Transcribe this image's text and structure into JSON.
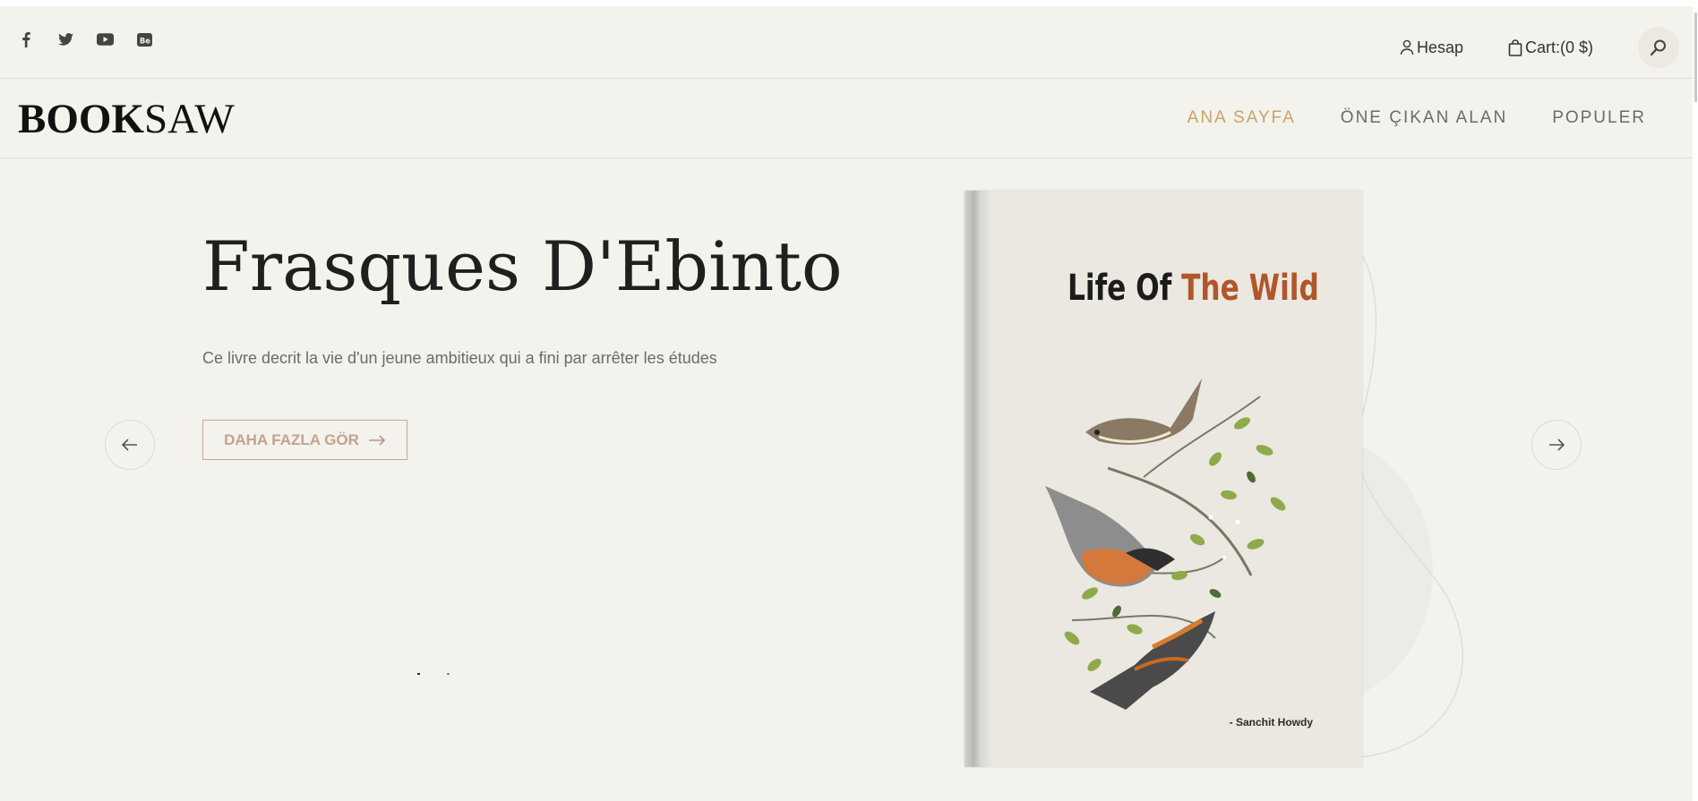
{
  "topbar": {
    "social": [
      {
        "icon": "facebook-icon"
      },
      {
        "icon": "twitter-icon"
      },
      {
        "icon": "youtube-icon"
      },
      {
        "icon": "behance-icon"
      }
    ],
    "account_label": "Hesap",
    "cart_label": "Cart:(0 $)"
  },
  "navbar": {
    "logo_bold": "BOOK",
    "logo_light": "SAW",
    "links": [
      {
        "label": "ANA SAYFA",
        "active": true
      },
      {
        "label": "ÖNE ÇIKAN ALAN",
        "active": false
      },
      {
        "label": "POPULER",
        "active": false
      }
    ]
  },
  "hero": {
    "title": "Frasques D'Ebinto",
    "description": "Ce livre decrit la vie d'un jeune ambitieux qui a fini par arrêter les études",
    "cta_label": "DAHA FAZLA GÖR",
    "book": {
      "title_part1": "Life Of ",
      "title_part2": "The Wild",
      "author": "- Sanchit Howdy"
    }
  },
  "colors": {
    "background": "#f3f2ec",
    "accent": "#c9a26b",
    "cta": "#c4a28f",
    "book_accent": "#b0562b"
  }
}
